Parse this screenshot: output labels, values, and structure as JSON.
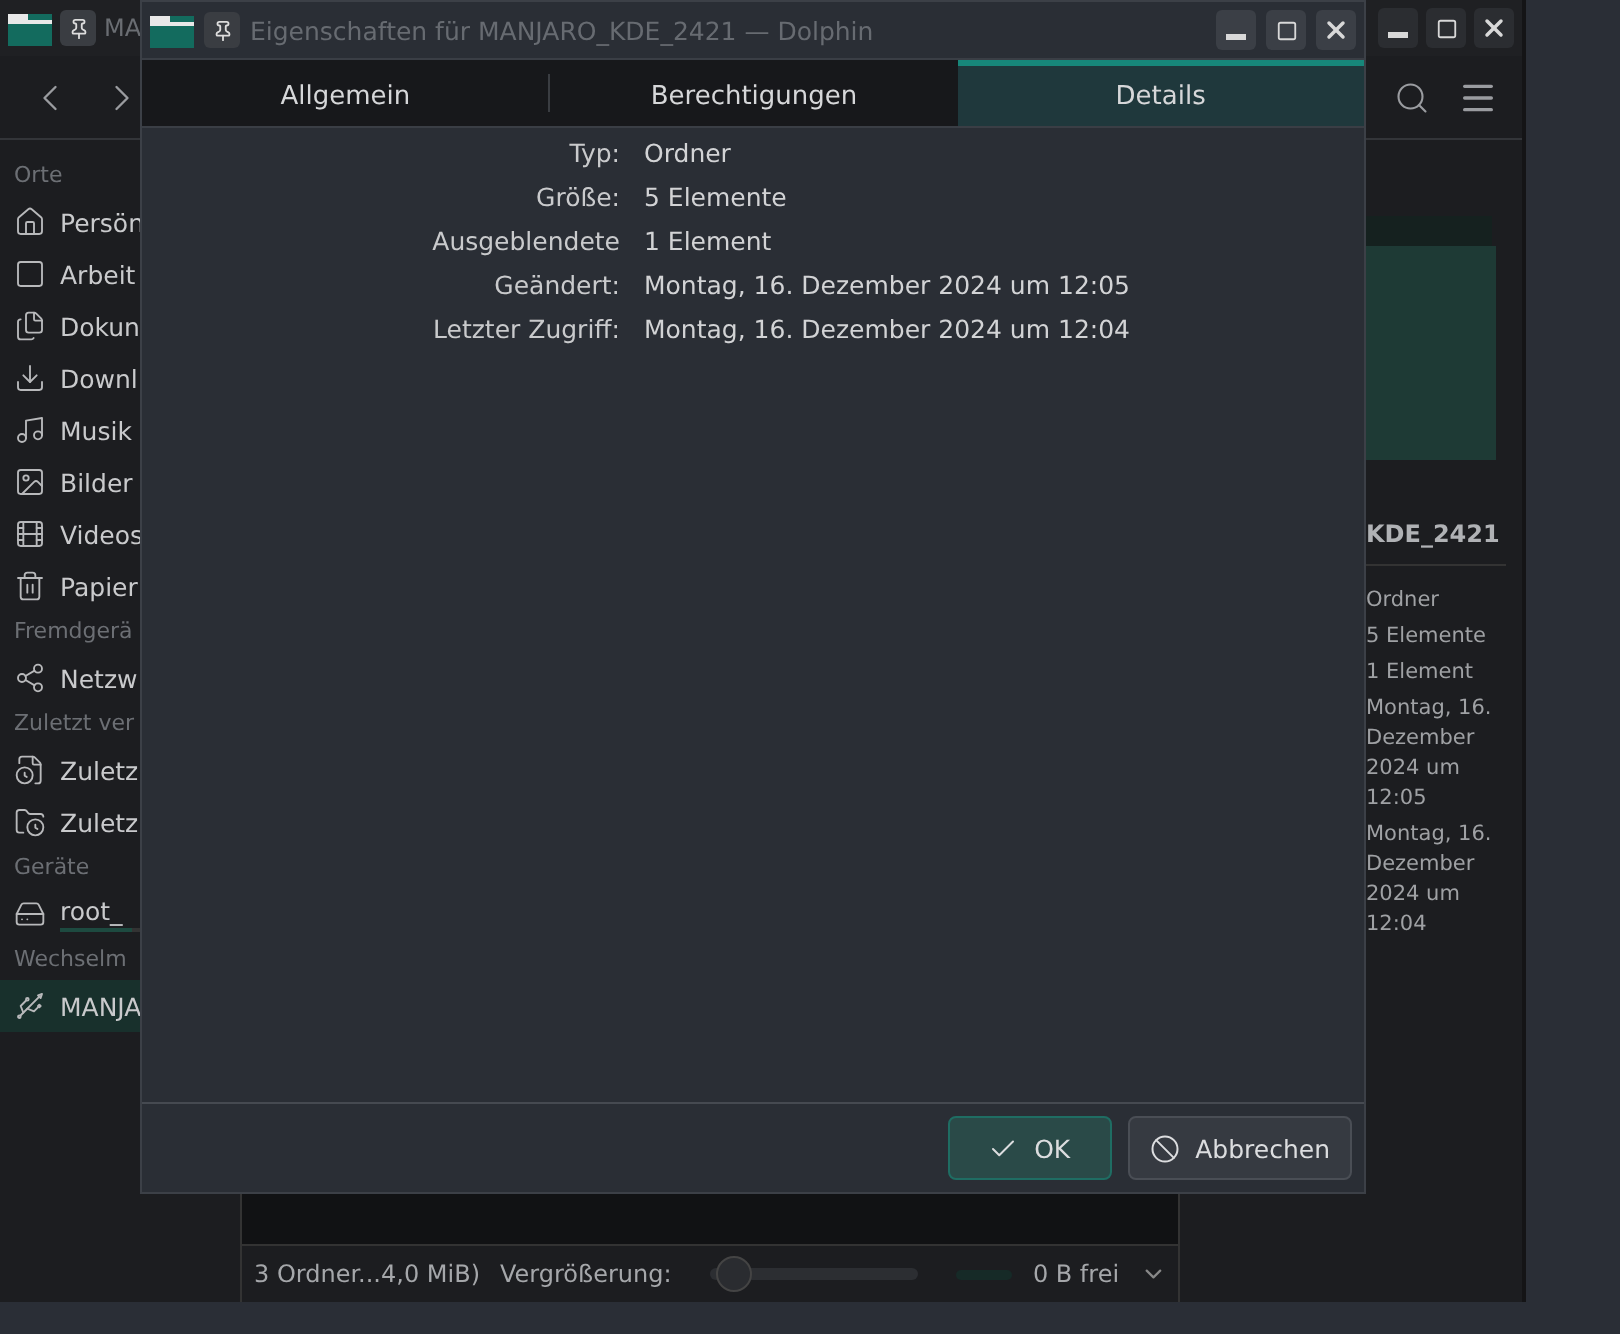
{
  "background_window": {
    "title": "MA",
    "sidebar": [
      {
        "header": "Orte",
        "items": [
          {
            "label": "Persön",
            "selected": false
          },
          {
            "label": "Arbeit",
            "selected": false
          },
          {
            "label": "Dokun",
            "selected": false
          },
          {
            "label": "Downl",
            "selected": false
          },
          {
            "label": "Musik",
            "selected": false
          },
          {
            "label": "Bilder",
            "selected": false
          },
          {
            "label": "Videos",
            "selected": false
          },
          {
            "label": "Papier",
            "selected": false
          }
        ]
      },
      {
        "header": "Fremdgerä",
        "items": [
          {
            "label": "Netzw",
            "selected": false
          }
        ]
      },
      {
        "header": "Zuletzt ver",
        "items": [
          {
            "label": "Zuletz",
            "selected": false
          },
          {
            "label": "Zuletz",
            "selected": false
          }
        ]
      },
      {
        "header": "Geräte",
        "items": [
          {
            "label": "root_",
            "selected": false,
            "level": 0.6
          }
        ]
      },
      {
        "header": "Wechselm",
        "items": [
          {
            "label": "MANJA",
            "selected": true
          }
        ]
      }
    ],
    "info_panel": {
      "title": "KDE_2421",
      "values": [
        "Ordner",
        "5 Elemente",
        "1 Element",
        "Montag, 16. Dezember 2024 um 12:05",
        "Montag, 16. Dezember 2024 um 12:04"
      ]
    },
    "status_bar": {
      "summary": "3 Ordner...4,0 MiB)",
      "zoom_label": "Vergrößerung:",
      "zoom": {
        "level": 0.12
      },
      "free_space": "0 B frei"
    }
  },
  "dialog": {
    "title": "Eigenschaften für MANJARO_KDE_2421 — Dolphin",
    "tabs": [
      {
        "label": "Allgemein",
        "selected": false
      },
      {
        "label": "Berechtigungen",
        "selected": false
      },
      {
        "label": "Details",
        "selected": true
      }
    ],
    "fields": [
      {
        "label": "Typ:",
        "value": "Ordner"
      },
      {
        "label": "Größe:",
        "value": "5 Elemente"
      },
      {
        "label": "Ausgeblendete",
        "value": "1 Element"
      },
      {
        "label": "Geändert:",
        "value": "Montag, 16. Dezember 2024 um 12:05"
      },
      {
        "label": "Letzter Zugriff:",
        "value": "Montag, 16. Dezember 2024 um 12:04"
      }
    ],
    "buttons": [
      {
        "label": "OK",
        "kind": "ok"
      },
      {
        "label": "Abbrechen",
        "kind": "cancel"
      }
    ]
  }
}
